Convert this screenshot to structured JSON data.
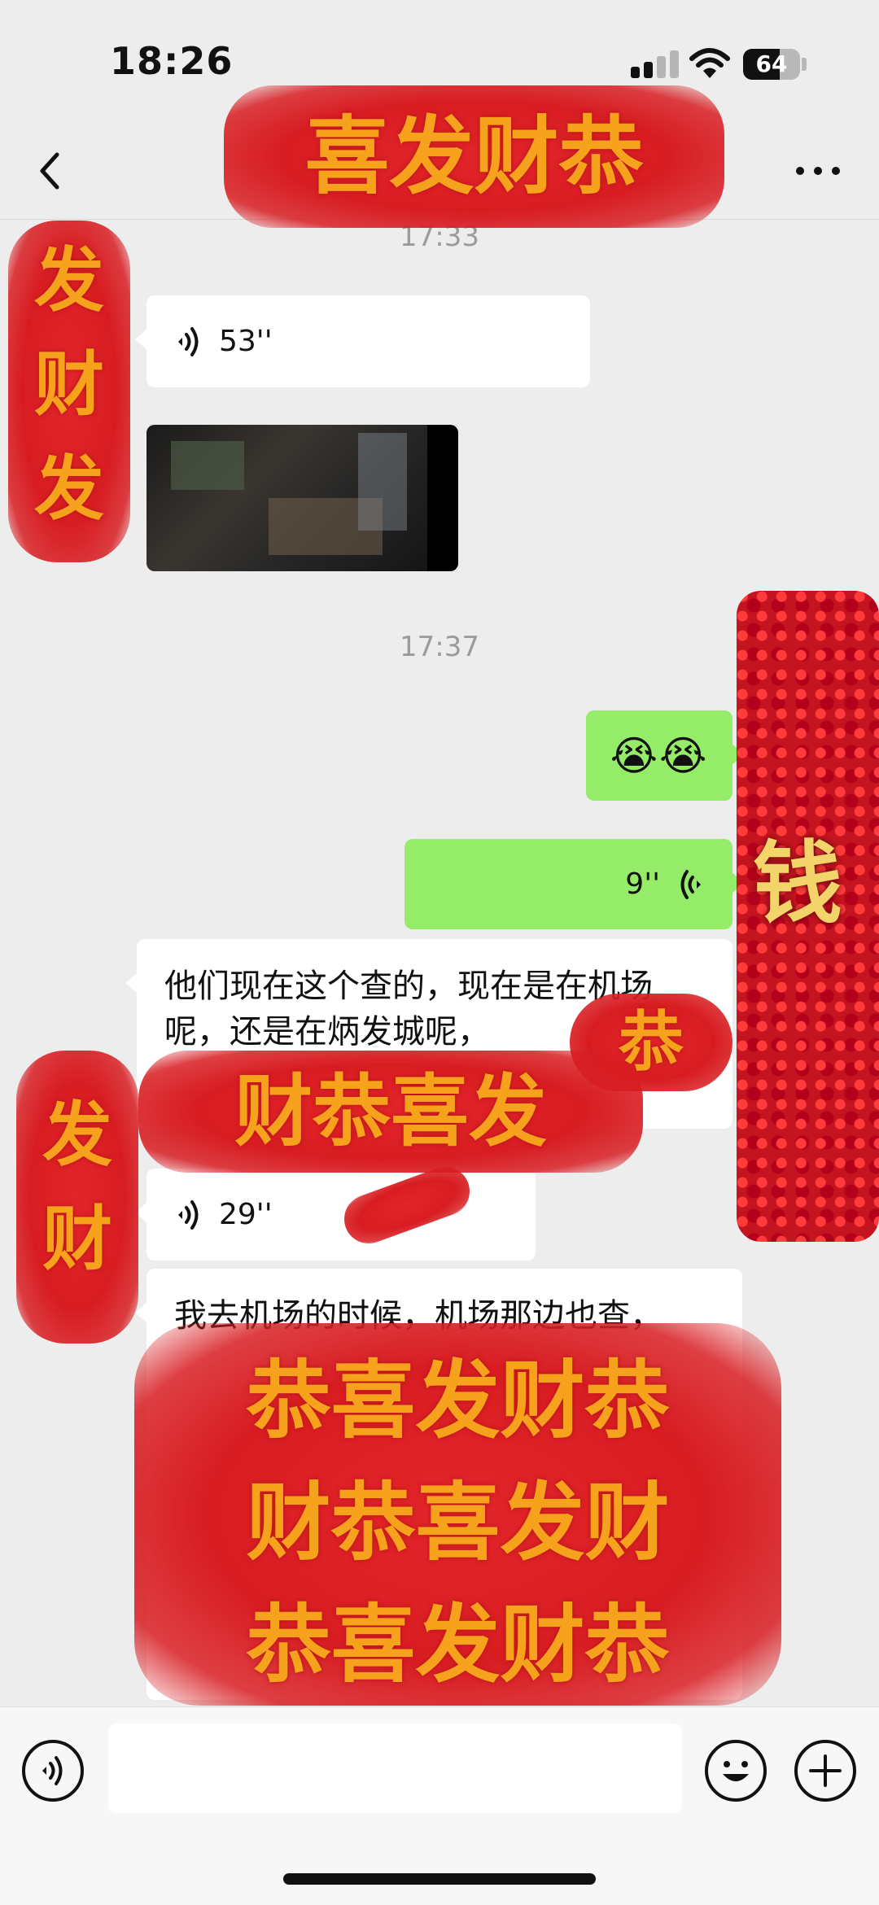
{
  "status_bar": {
    "time": "18:26",
    "battery": "64"
  },
  "nav": {
    "back_icon": "chevron-left-icon",
    "more_icon": "more-horizontal-icon"
  },
  "messages": {
    "ts1": "17:33",
    "voice1_duration": "53''",
    "ts2": "17:37",
    "emoji_msg": "😭😭",
    "voice2_duration": "9''",
    "text1": "他们现在这个查的，现在是在机场呢，还是在炳发城呢，",
    "voice3_duration": "29''",
    "text2": "我去机场的时候，机场那边也查，"
  },
  "overlays": {
    "top_banner": "喜发财恭",
    "left_upper": "发财发",
    "right_sticker": "钱",
    "mid_banner": "财恭喜发",
    "mid_right": "恭",
    "left_lower": "发财",
    "big_row1": "恭喜发财恭",
    "big_row2": "财恭喜发财",
    "big_row3": "恭喜发财恭"
  },
  "colors": {
    "background": "#ededed",
    "bubble_self": "#95ec69",
    "bubble_other": "#ffffff",
    "sticker_red": "#d81d22",
    "sticker_gold": "#f6a21c"
  }
}
